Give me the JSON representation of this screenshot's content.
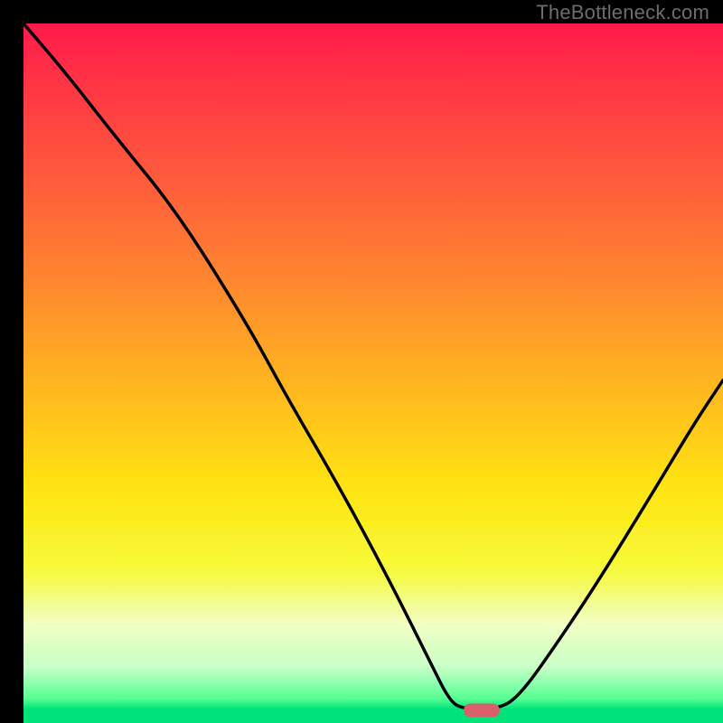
{
  "watermark": {
    "text": "TheBottleneck.com"
  },
  "marker": {
    "color": "#d9606a",
    "x_pct": 0.655,
    "y_pct": 0.982
  },
  "gradient_stops": [
    {
      "pct": 0,
      "color": "#ff1a4b"
    },
    {
      "pct": 8,
      "color": "#ff3345"
    },
    {
      "pct": 22,
      "color": "#ff5a3c"
    },
    {
      "pct": 38,
      "color": "#ff8a2f"
    },
    {
      "pct": 52,
      "color": "#ffb71f"
    },
    {
      "pct": 66,
      "color": "#ffe312"
    },
    {
      "pct": 77,
      "color": "#f8f82a"
    },
    {
      "pct": 86,
      "color": "#f0ffbf"
    },
    {
      "pct": 92,
      "color": "#c8ffc8"
    },
    {
      "pct": 96.5,
      "color": "#57ff93"
    },
    {
      "pct": 98,
      "color": "#00e37a"
    },
    {
      "pct": 100,
      "color": "#00e37a"
    }
  ],
  "light_strips_pct": [
    {
      "top": 72.0,
      "height": 6.0,
      "alpha": 0.2
    },
    {
      "top": 82.0,
      "height": 6.0,
      "alpha": 0.28
    }
  ],
  "chart_data": {
    "type": "line",
    "title": "",
    "xlabel": "",
    "ylabel": "",
    "xlim": [
      0,
      100
    ],
    "ylim": [
      0,
      100
    ],
    "note": "Bottleneck-style V-curve. Y is percent height from bottom (100 = top). Minimum at ~x=65.",
    "curve_points": [
      {
        "x": 0,
        "y": 100
      },
      {
        "x": 6,
        "y": 93
      },
      {
        "x": 13,
        "y": 84
      },
      {
        "x": 22,
        "y": 73
      },
      {
        "x": 32,
        "y": 57
      },
      {
        "x": 38,
        "y": 46
      },
      {
        "x": 45,
        "y": 34
      },
      {
        "x": 52,
        "y": 21
      },
      {
        "x": 58,
        "y": 9
      },
      {
        "x": 61,
        "y": 3
      },
      {
        "x": 63,
        "y": 2
      },
      {
        "x": 68,
        "y": 2
      },
      {
        "x": 71,
        "y": 4
      },
      {
        "x": 76,
        "y": 11
      },
      {
        "x": 82,
        "y": 20
      },
      {
        "x": 90,
        "y": 33
      },
      {
        "x": 96,
        "y": 43
      },
      {
        "x": 100,
        "y": 49
      }
    ],
    "marker": {
      "x": 65.5,
      "y": 1.8,
      "shape": "rounded-rect",
      "color": "#d9606a"
    }
  }
}
